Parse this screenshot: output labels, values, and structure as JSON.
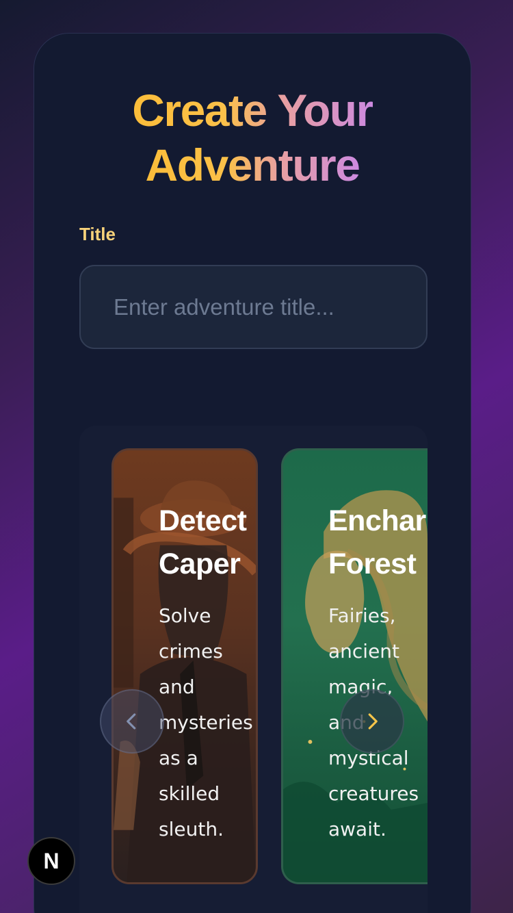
{
  "header": {
    "title_line1": "Create Your",
    "title_line2": "Adventure"
  },
  "form": {
    "title_label": "Title",
    "title_placeholder": "Enter adventure title...",
    "title_value": ""
  },
  "carousel": {
    "cards": [
      {
        "title_line1": "Detect",
        "title_line2": "Caper",
        "description": "Solve crimes and mysteries as a skilled sleuth."
      },
      {
        "title_line1": "Enchar",
        "title_line2": "Forest",
        "description": "Fairies, ancient magic, and mystical creatures await."
      }
    ],
    "prev_icon": "chevron-left-icon",
    "next_icon": "chevron-right-icon"
  },
  "badge": {
    "label": "N"
  },
  "colors": {
    "panel_bg": "#131a31",
    "label": "#f7d27a",
    "gradient_start": "#fbbd3a",
    "gradient_end": "#cc8ae0",
    "next_chevron": "#f5c54a",
    "prev_chevron": "#8390b0"
  }
}
